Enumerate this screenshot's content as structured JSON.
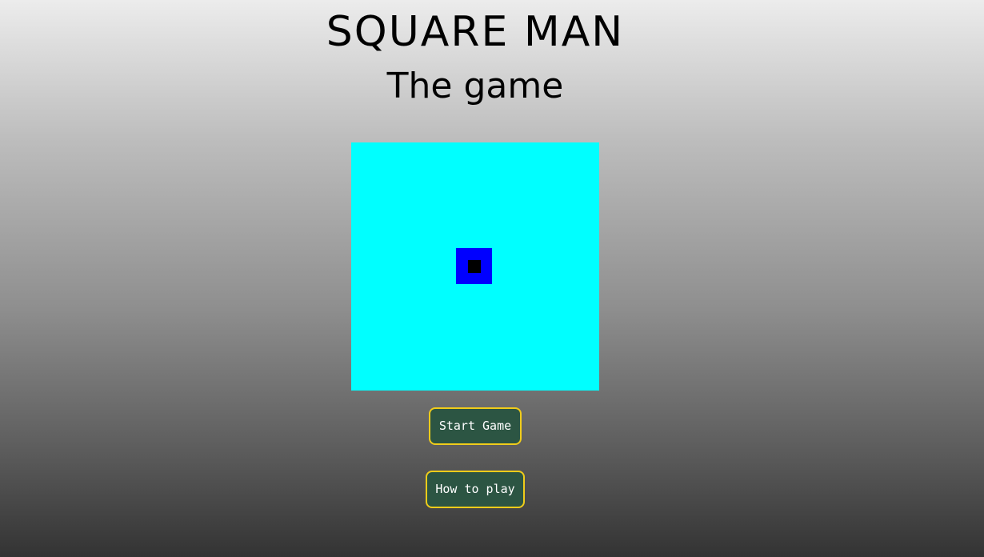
{
  "header": {
    "title": "SQUARE MAN",
    "subtitle": "The game"
  },
  "game": {
    "board_color": "#00ffff",
    "player_outer_color": "#0000ff",
    "player_inner_color": "#000000"
  },
  "buttons": {
    "start_label": "Start Game",
    "how_label": "How to play",
    "fill_color": "#2c5543",
    "border_color": "#f0cc1a"
  }
}
